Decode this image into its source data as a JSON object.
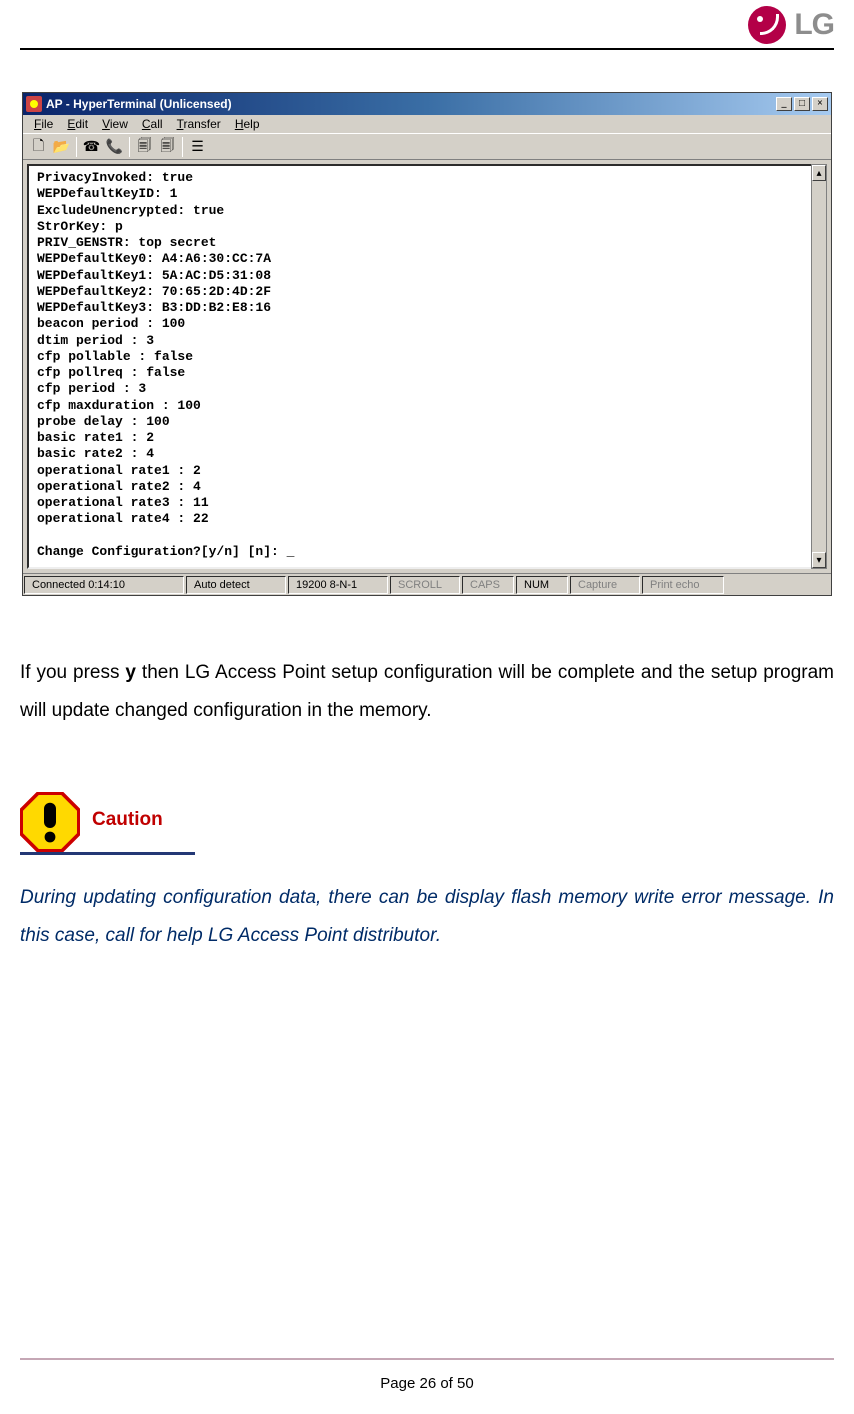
{
  "logo_text": "LG",
  "hyperterminal": {
    "title": "AP - HyperTerminal (Unlicensed)",
    "menu": {
      "file": "File",
      "edit": "Edit",
      "view": "View",
      "call": "Call",
      "transfer": "Transfer",
      "help": "Help"
    },
    "toolbar_icons": {
      "new": "new-doc-icon",
      "open": "open-folder-icon",
      "connect": "phone-connect-icon",
      "disconnect": "phone-disconnect-icon",
      "send": "send-icon",
      "receive": "receive-icon",
      "properties": "properties-icon"
    },
    "terminal_content": "PrivacyInvoked: true\nWEPDefaultKeyID: 1\nExcludeUnencrypted: true\nStrOrKey: p\nPRIV_GENSTR: top secret\nWEPDefaultKey0: A4:A6:30:CC:7A\nWEPDefaultKey1: 5A:AC:D5:31:08\nWEPDefaultKey2: 70:65:2D:4D:2F\nWEPDefaultKey3: B3:DD:B2:E8:16\nbeacon period : 100\ndtim period : 3\ncfp pollable : false\ncfp pollreq : false\ncfp period : 3\ncfp maxduration : 100\nprobe delay : 100\nbasic rate1 : 2\nbasic rate2 : 4\noperational rate1 : 2\noperational rate2 : 4\noperational rate3 : 11\noperational rate4 : 22\n\nChange Configuration?[y/n] [n]: _",
    "statusbar": {
      "connected": "Connected 0:14:10",
      "detect": "Auto detect",
      "baud": "19200 8-N-1",
      "scroll": "SCROLL",
      "caps": "CAPS",
      "num": "NUM",
      "capture": "Capture",
      "print_echo": "Print echo"
    }
  },
  "body": {
    "paragraph_prefix": "If you press ",
    "paragraph_bold": "y",
    "paragraph_suffix": " then LG Access Point setup configuration will be complete and the setup program will update changed configuration in the memory."
  },
  "caution": {
    "label": "Caution",
    "text": "During updating configuration data, there can be display flash memory write error message. In this case, call for help LG Access Point distributor."
  },
  "footer": {
    "page_text": "Page 26 of 50"
  }
}
